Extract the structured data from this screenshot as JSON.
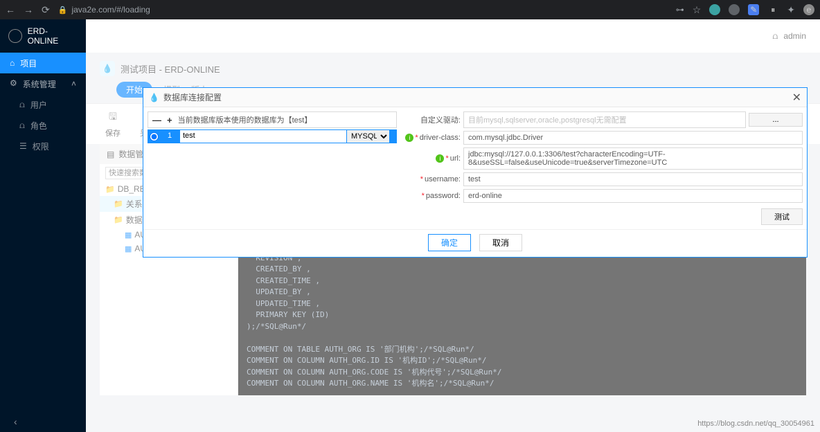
{
  "browser": {
    "url": "java2e.com/#/loading",
    "key_icon": "⊶"
  },
  "app": {
    "brand": "ERD-ONLINE",
    "user": "admin"
  },
  "sidebar": {
    "items": [
      {
        "icon": "⌂",
        "label": "项目"
      },
      {
        "icon": "⚙",
        "label": "系统管理",
        "chev": "˄"
      },
      {
        "icon": "",
        "label": "用户",
        "sub": true,
        "pre": "⩍"
      },
      {
        "icon": "",
        "label": "角色",
        "sub": true,
        "pre": "⩍"
      },
      {
        "icon": "",
        "label": "权限",
        "sub": true,
        "pre": "☰"
      }
    ],
    "collapse": "‹"
  },
  "breadcrumb": "测试项目 - ERD-ONLINE",
  "tabs": {
    "active": "开始",
    "t1": "模型",
    "t2": "版本"
  },
  "toolbar": [
    {
      "icon": "🖫",
      "label": "保存"
    },
    {
      "icon": "🖫",
      "label": "另存为"
    }
  ],
  "tree": {
    "tab": "数据管",
    "search_ph": "快速搜索数据表",
    "nodes": [
      {
        "type": "folder",
        "label": "DB_REVERSE_",
        "indent": 0
      },
      {
        "type": "folder-sel",
        "label": "关系图",
        "indent": 1
      },
      {
        "type": "folder",
        "label": "数据表",
        "indent": 1
      },
      {
        "type": "table",
        "label": "AUTH_C",
        "indent": 2
      },
      {
        "type": "table",
        "label": "AUTH_C",
        "indent": 2
      }
    ]
  },
  "code": "  NAME ,\n  FULL_NAME ,\n  SHORT_NAME ,\n  SORT_CODE ,\n  PARENT_ID ,\n  LEVEL ,\n  ORG_TYPE ,\n  LEADER ,\n  REMARK ,\n  REVISION ,\n  CREATED_BY ,\n  CREATED_TIME ,\n  UPDATED_BY ,\n  UPDATED_TIME ,\n  PRIMARY KEY (ID)\n);/*SQL@Run*/\n\nCOMMENT ON TABLE AUTH_ORG IS '部门机构';/*SQL@Run*/\nCOMMENT ON COLUMN AUTH_ORG.ID IS '机构ID';/*SQL@Run*/\nCOMMENT ON COLUMN AUTH_ORG.CODE IS '机构代号';/*SQL@Run*/\nCOMMENT ON COLUMN AUTH_ORG.NAME IS '机构名';/*SQL@Run*/",
  "dialog": {
    "title": "数据库连接配置",
    "left": {
      "minus": "—",
      "plus": "+",
      "header": "当前数据库版本使用的数据库为【test】",
      "row": {
        "num": "1",
        "name": "test",
        "type": "MYSQL"
      }
    },
    "right": {
      "custom_driver_label": "自定义驱动:",
      "custom_driver_ph": "目前mysql,sqlserver,oracle,postgresql无需配置",
      "ellipsis": "...",
      "driver_class_label": "driver-class:",
      "driver_class": "com.mysql.jdbc.Driver",
      "url_label": "url:",
      "url": "jdbc:mysql://127.0.0.1:3306/test?characterEncoding=UTF-8&useSSL=false&useUnicode=true&serverTimezone=UTC",
      "username_label": "username:",
      "username": "test",
      "password_label": "password:",
      "password": "erd-online",
      "test_btn": "测试"
    },
    "ok": "确定",
    "cancel": "取消"
  },
  "watermark": "https://blog.csdn.net/qq_30054961"
}
